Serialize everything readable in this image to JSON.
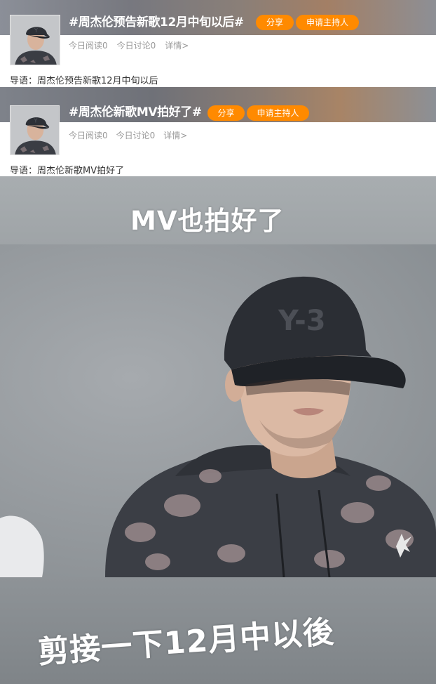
{
  "topics": [
    {
      "title": "#周杰伦预告新歌12月中旬以后#",
      "share_label": "分享",
      "host_label": "申请主持人",
      "reads": "今日阅读0",
      "discussions": "今日讨论0",
      "details": "详情>",
      "lead": "导语：周杰伦预告新歌12月中旬以后"
    },
    {
      "title": "#周杰伦新歌MV拍好了#",
      "share_label": "分享",
      "host_label": "申请主持人",
      "reads": "今日阅读0",
      "discussions": "今日讨论0",
      "details": "详情>",
      "lead": "导语：周杰伦新歌MV拍好了"
    }
  ],
  "photo": {
    "caption_top": "MV也拍好了",
    "caption_bottom": "剪接一下12月中以後"
  },
  "colors": {
    "accent": "#ff8a00",
    "stats_text": "#999999",
    "body_text": "#333333"
  },
  "icons": {
    "avatar": "avatar-image"
  }
}
